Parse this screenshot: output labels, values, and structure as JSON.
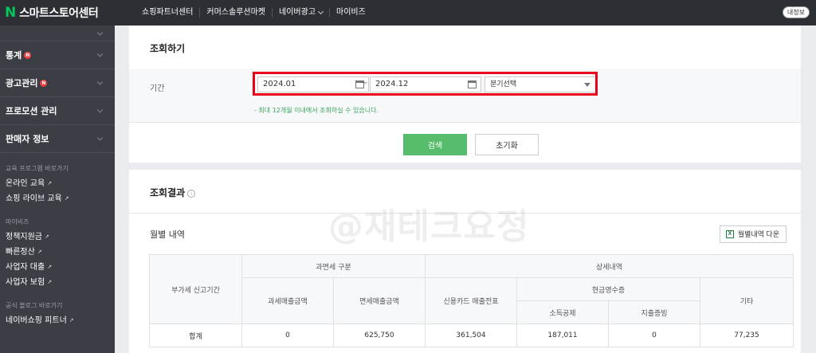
{
  "topbar": {
    "logo_letter": "N",
    "logo_text": "스마트스토어센터",
    "nav": [
      "쇼핑파트너센터",
      "커머스솔루션마켓",
      "네이버광고",
      "마이비즈"
    ],
    "my_info": "내정보"
  },
  "sidebar": {
    "menus": [
      {
        "label": "통계",
        "new": true
      },
      {
        "label": "광고관리",
        "new": true
      },
      {
        "label": "프로모션 관리",
        "new": false
      },
      {
        "label": "판매자 정보",
        "new": false
      }
    ],
    "new_badge": "N",
    "sections": [
      {
        "title": "교육 프로그램 바로가기",
        "links": [
          "온라인 교육",
          "쇼핑 라이브 교육"
        ]
      },
      {
        "title": "마이비즈",
        "links": [
          "정책지원금",
          "빠른정산",
          "사업자 대출",
          "사업자 보험"
        ]
      },
      {
        "title": "공식 블로그 바로가기",
        "links": [
          "네이버쇼핑 피트너"
        ]
      }
    ],
    "link_arrow": "↗"
  },
  "search_panel": {
    "title": "조회하기",
    "period_label": "기간",
    "start_date": "2024.01",
    "end_date": "2024.12",
    "separator": "~",
    "quarter_select": "분기선택",
    "notes": [
      "- 최대 12개월 이내에서 조회하실 수 있습니다."
    ],
    "search_button": "검색",
    "reset_button": "초기화",
    "accent_color": "#57bc6b",
    "highlight_color": "#e8001c"
  },
  "result_panel": {
    "title": "조회결과",
    "info_icon": "i",
    "monthly_title": "월별 내역",
    "download_button": "월별내역 다운",
    "download_icon": "X",
    "watermark": "@재테크요정",
    "table": {
      "group_headers": {
        "tax_type": "과면세 구분",
        "detail": "상세내역",
        "cash_receipt": "현금영수증"
      },
      "columns": {
        "period": "부가세 신고기간",
        "taxable": "과세매출금액",
        "exempt": "면세매출금액",
        "card": "신용카드 매출전표",
        "income_deduction": "소득공제",
        "expense_proof": "지출증빙",
        "etc": "기타"
      },
      "rows": [
        {
          "period": "합계",
          "taxable": "0",
          "exempt": "625,750",
          "card": "361,504",
          "income_deduction": "187,011",
          "expense_proof": "0",
          "etc": "77,235"
        }
      ]
    }
  }
}
